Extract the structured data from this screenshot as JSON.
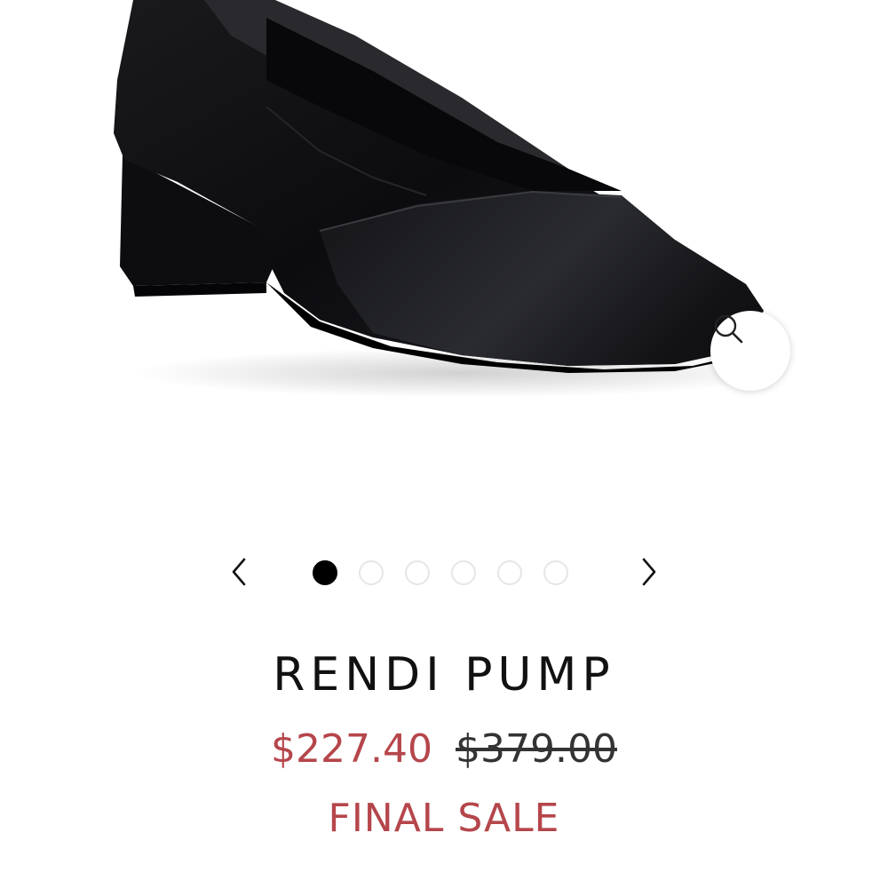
{
  "product": {
    "name": "RENDI PUMP",
    "sale_price": "$227.40",
    "original_price": "$379.00",
    "badge": "FINAL SALE"
  },
  "gallery": {
    "image_count": 6,
    "active_index": 0,
    "zoom_icon": "search-icon",
    "prev_icon": "chevron-left-icon",
    "next_icon": "chevron-right-icon"
  },
  "colors": {
    "sale": "#b5464b",
    "text": "#111111",
    "dot_active": "#000000",
    "dot_inactive_border": "#e6e6e6"
  }
}
